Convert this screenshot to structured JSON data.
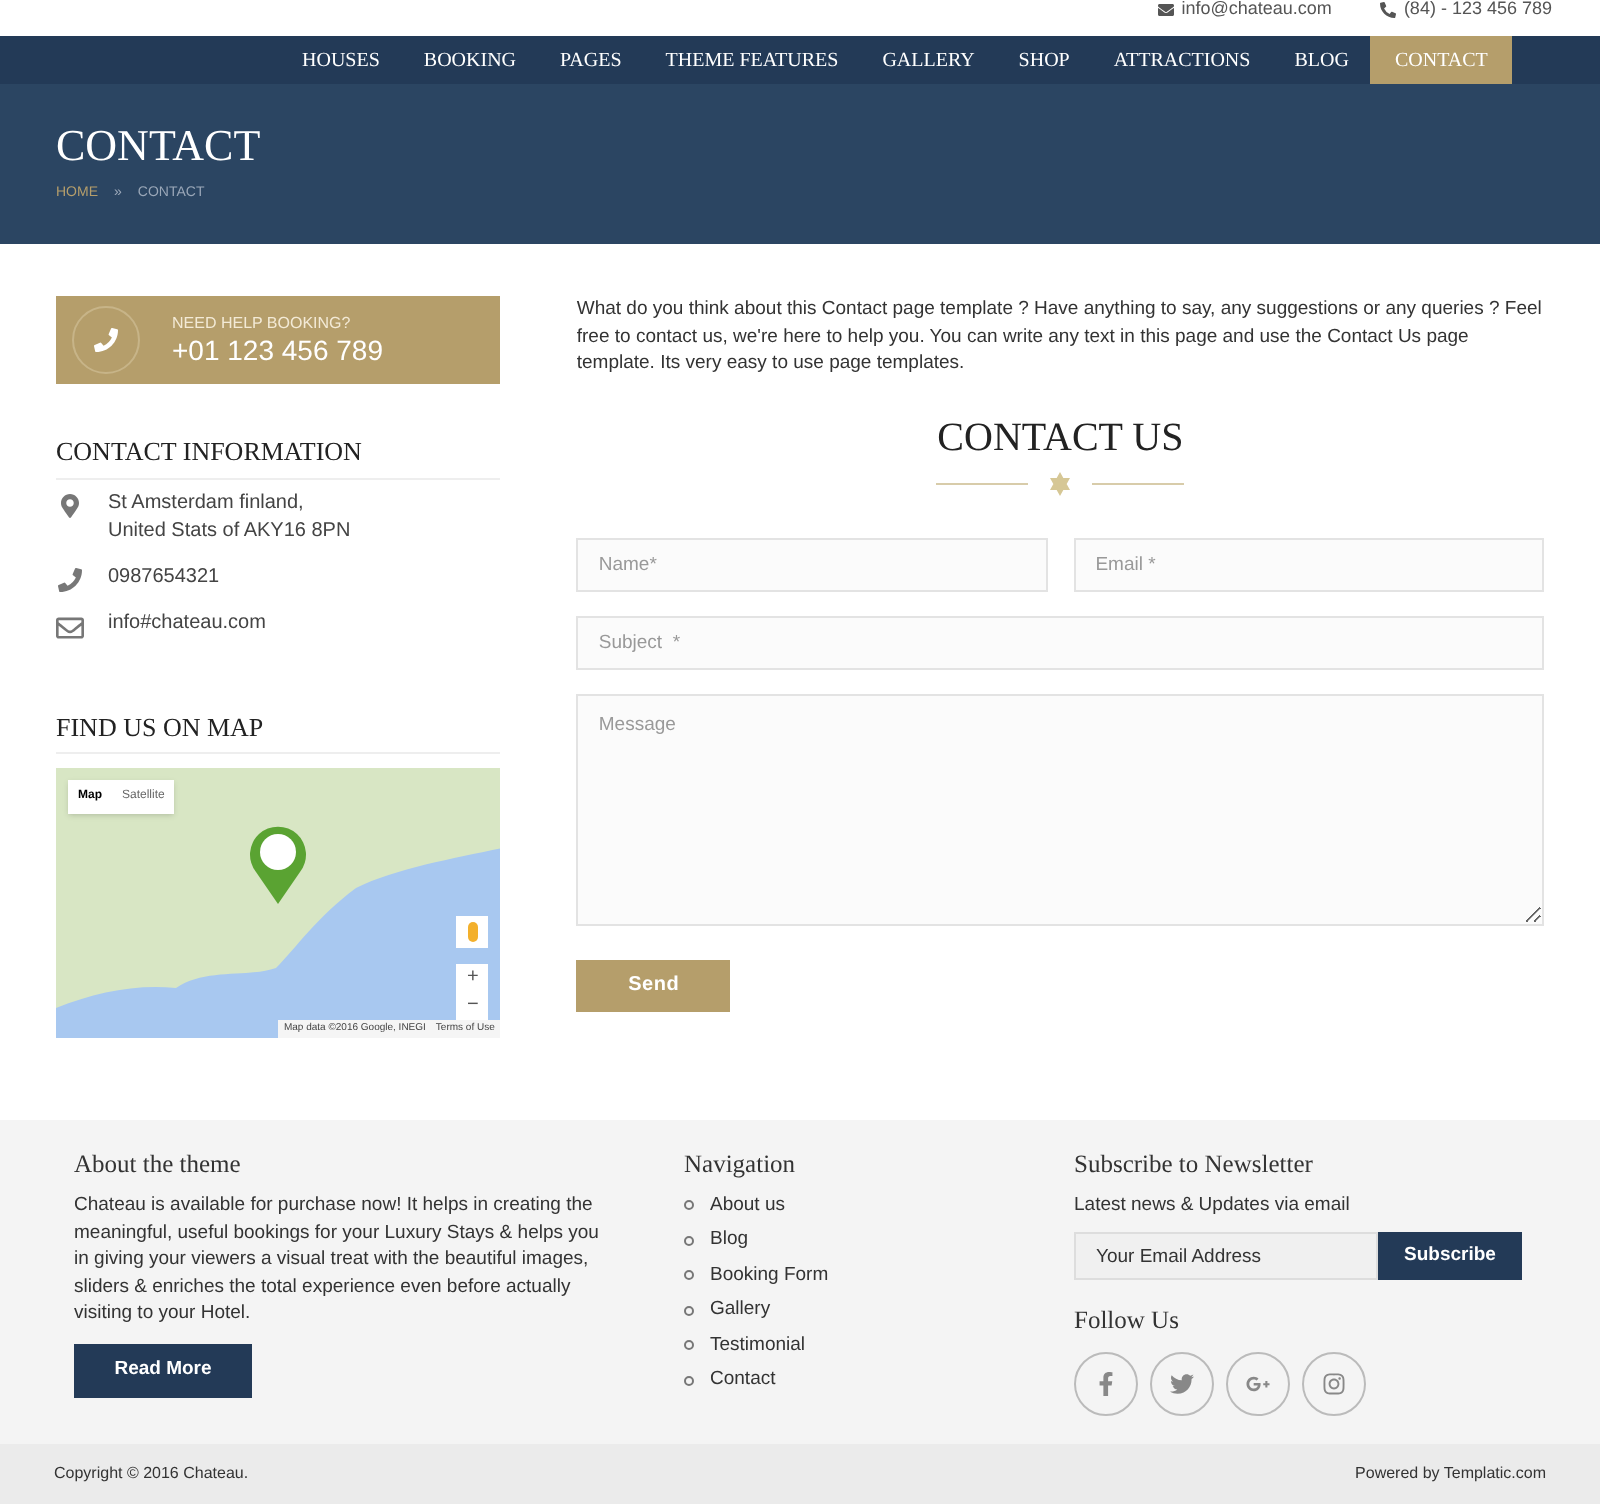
{
  "top_bar": {
    "email": "info@chateau.com",
    "phone": "(84) - 123 456 789"
  },
  "nav": {
    "items": [
      {
        "label": "HOUSES",
        "selected": false
      },
      {
        "label": "BOOKING",
        "selected": false
      },
      {
        "label": "PAGES",
        "selected": false
      },
      {
        "label": "THEME FEATURES",
        "selected": false
      },
      {
        "label": "GALLERY",
        "selected": false
      },
      {
        "label": "SHOP",
        "selected": false
      },
      {
        "label": "ATTRACTIONS",
        "selected": false
      },
      {
        "label": "BLOG",
        "selected": false
      },
      {
        "label": "CONTACT",
        "selected": true
      }
    ]
  },
  "page_header": {
    "title": "CONTACT",
    "breadcrumb": [
      "HOME",
      "»",
      "CONTACT"
    ]
  },
  "help_box": {
    "label": "NEED HELP BOOKING?",
    "phone": "+01 123 456 789"
  },
  "contact_information": {
    "title": "CONTACT INFORMATION",
    "items": [
      {
        "kind": "address",
        "lines": [
          "St Amsterdam finland,",
          "United Stats of AKY16 8PN"
        ]
      },
      {
        "kind": "phone",
        "lines": [
          "0987654321"
        ]
      },
      {
        "kind": "email",
        "lines": [
          "info#chateau.com"
        ]
      }
    ]
  },
  "map": {
    "title": "FIND US ON MAP",
    "tabs": [
      {
        "label": "Map",
        "selected": true
      },
      {
        "label": "Satellite",
        "selected": false
      }
    ],
    "zoom_in": "+",
    "zoom_out": "−",
    "attribution": "Map data ©2016 Google, INEGI",
    "terms": "Terms of Use"
  },
  "intro": "What do you think about this Contact page template ? Have anything to say, any suggestions or any queries ? Feel free to contact us, we're here to help you. You can write any text in this page and use the Contact Us page template. Its very easy to use page templates.",
  "form": {
    "title": "CONTACT US",
    "name": {
      "placeholder": "Name*"
    },
    "email": {
      "placeholder": "Email *"
    },
    "subject": {
      "placeholder": "Subject  *"
    },
    "message": {
      "placeholder": "Message"
    },
    "submit": "Send"
  },
  "footer": {
    "about": {
      "title": "About the theme",
      "text": "Chateau is available for purchase now! It helps in creating the meaningful, useful bookings for your Luxury Stays & helps you in giving your viewers a visual treat with the beautiful images, sliders & enriches the total experience even before actually visiting to your Hotel.",
      "button": "Read More"
    },
    "navigation": {
      "title": "Navigation",
      "items": [
        "About us",
        "Blog",
        "Booking Form",
        "Gallery",
        "Testimonial",
        "Contact"
      ]
    },
    "newsletter": {
      "title": "Subscribe to Newsletter",
      "text": "Latest news & Updates via email",
      "placeholder": "Your Email Address",
      "button": "Subscribe"
    },
    "follow": {
      "title": "Follow Us",
      "icons": [
        {
          "kind": "facebook"
        },
        {
          "kind": "twitter"
        },
        {
          "kind": "google-plus"
        },
        {
          "kind": "instagram"
        }
      ]
    }
  },
  "bottom_bar": {
    "copyright": "Copyright © 2016 Chateau.",
    "powered": "Powered by Templatic.com"
  }
}
